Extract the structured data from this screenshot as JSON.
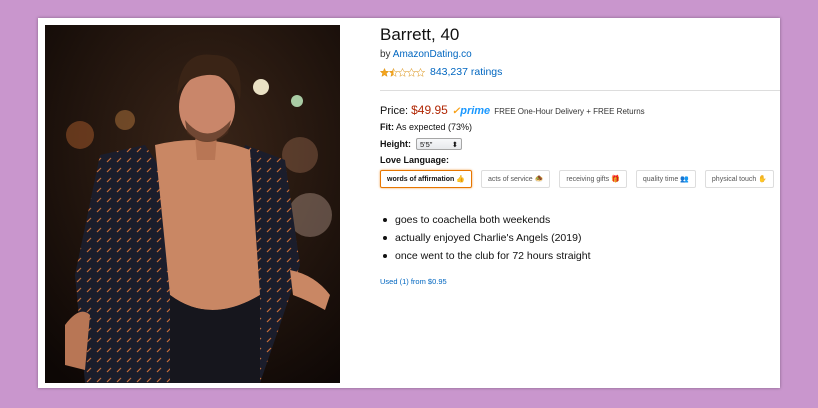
{
  "product": {
    "title": "Barrett, 40",
    "by_prefix": "by",
    "brand": "AmazonDating.co",
    "rating_count": "843,237 ratings",
    "star_rating": 1.5,
    "star_color": "#f4a41c"
  },
  "pricing": {
    "label": "Price:",
    "price": "$49.95",
    "prime_check": "✓",
    "prime_text": "prime",
    "delivery": "FREE One-Hour Delivery + FREE Returns"
  },
  "fit": {
    "label": "Fit:",
    "value": "As expected (73%)"
  },
  "height": {
    "label": "Height:",
    "selected": "5'5\"",
    "arrow": "⬍"
  },
  "love_language": {
    "label": "Love Language:",
    "options": [
      {
        "label": "words of affirmation 👍",
        "selected": true
      },
      {
        "label": "acts of service 🧆",
        "selected": false
      },
      {
        "label": "receiving gifts 🎁",
        "selected": false
      },
      {
        "label": "quality time 👥",
        "selected": false
      },
      {
        "label": "physical touch ✋",
        "selected": false
      }
    ]
  },
  "bullets": [
    "goes to coachella both weekends",
    "actually enjoyed Charlie's Angels (2019)",
    "once went to the club for 72 hours straight"
  ],
  "used_offer": "Used (1) from $0.95",
  "colors": {
    "background": "#c996cd",
    "link": "#0066c0",
    "price": "#b12704",
    "prime": "#1a98ff",
    "selected_border": "#e77600"
  }
}
